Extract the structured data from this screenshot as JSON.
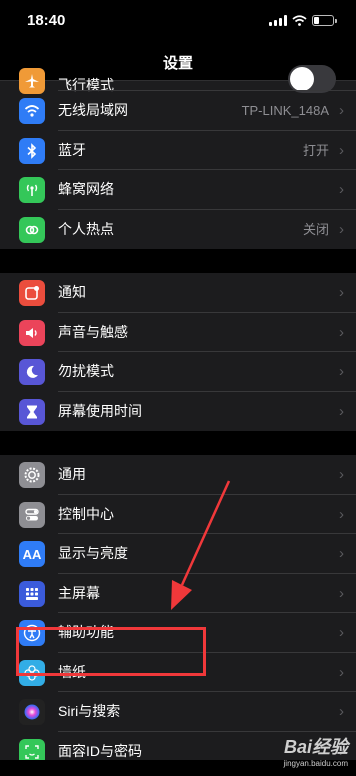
{
  "status_bar": {
    "time": "18:40"
  },
  "nav": {
    "title": "设置"
  },
  "groups": [
    [
      {
        "key": "airplane",
        "label": "飞行模式",
        "value": "",
        "icon": "airplane-icon",
        "color": "#f09a37",
        "toggle": false,
        "clipped": true
      },
      {
        "key": "wifi",
        "label": "无线局域网",
        "value": "TP-LINK_148A",
        "icon": "wifi-icon",
        "color": "#2f7cf6"
      },
      {
        "key": "bluetooth",
        "label": "蓝牙",
        "value": "打开",
        "icon": "bluetooth-icon",
        "color": "#2f7cf6"
      },
      {
        "key": "cellular",
        "label": "蜂窝网络",
        "value": "",
        "icon": "cellular-icon",
        "color": "#34c759"
      },
      {
        "key": "hotspot",
        "label": "个人热点",
        "value": "关闭",
        "icon": "hotspot-icon",
        "color": "#34c759"
      }
    ],
    [
      {
        "key": "notifications",
        "label": "通知",
        "value": "",
        "icon": "notifications-icon",
        "color": "#eb4d3d"
      },
      {
        "key": "sounds",
        "label": "声音与触感",
        "value": "",
        "icon": "sound-icon",
        "color": "#eb445a"
      },
      {
        "key": "dnd",
        "label": "勿扰模式",
        "value": "",
        "icon": "moon-icon",
        "color": "#5856d6"
      },
      {
        "key": "screentime",
        "label": "屏幕使用时间",
        "value": "",
        "icon": "hourglass-icon",
        "color": "#5856d6"
      }
    ],
    [
      {
        "key": "general",
        "label": "通用",
        "value": "",
        "icon": "gear-icon",
        "color": "#8e8e93"
      },
      {
        "key": "controlcenter",
        "label": "控制中心",
        "value": "",
        "icon": "control-center-icon",
        "color": "#8e8e93"
      },
      {
        "key": "display",
        "label": "显示与亮度",
        "value": "",
        "icon": "display-icon",
        "color": "#2f7cf6",
        "glyph": "AA"
      },
      {
        "key": "homescreen",
        "label": "主屏幕",
        "value": "",
        "icon": "home-screen-icon",
        "color": "#3b5bdb"
      },
      {
        "key": "accessibility",
        "label": "辅助功能",
        "value": "",
        "icon": "accessibility-icon",
        "color": "#2f7cf6"
      },
      {
        "key": "wallpaper",
        "label": "墙纸",
        "value": "",
        "icon": "wallpaper-icon",
        "color": "#32ade6"
      },
      {
        "key": "siri",
        "label": "Siri与搜索",
        "value": "",
        "icon": "siri-icon",
        "color": "#222222"
      },
      {
        "key": "faceid",
        "label": "面容ID与密码",
        "value": "",
        "icon": "face-id-icon",
        "color": "#34c759",
        "last": true
      }
    ]
  ],
  "watermark": {
    "logo": "Bai经验",
    "sub": "jingyan.baidu.com"
  }
}
